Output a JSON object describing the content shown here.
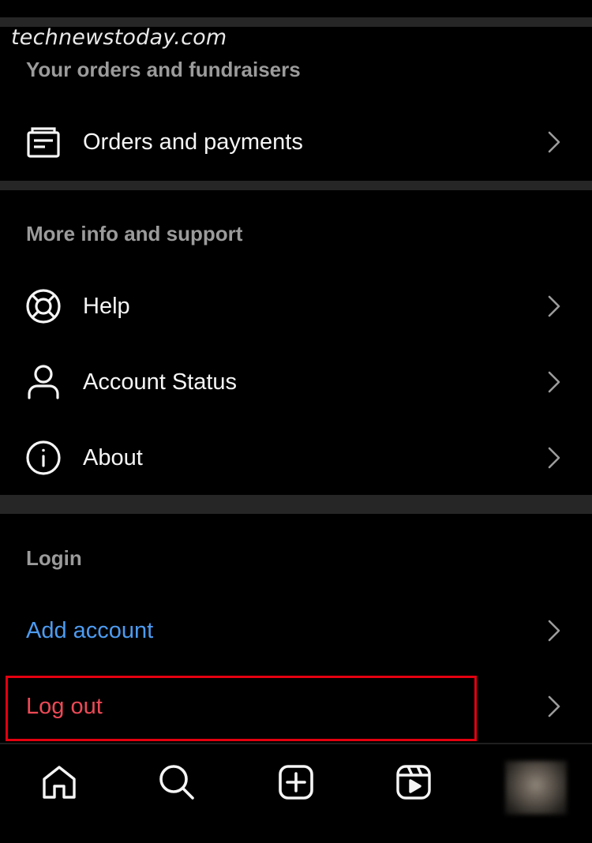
{
  "watermark": "technewstoday.com",
  "sections": {
    "orders": {
      "title": "Your orders and fundraisers",
      "items": [
        {
          "label": "Orders and payments",
          "icon": "receipt-icon"
        }
      ]
    },
    "support": {
      "title": "More info and support",
      "items": [
        {
          "label": "Help",
          "icon": "lifebuoy-icon"
        },
        {
          "label": "Account Status",
          "icon": "person-icon"
        },
        {
          "label": "About",
          "icon": "info-icon"
        }
      ]
    },
    "login": {
      "title": "Login",
      "items": [
        {
          "label": "Add account",
          "color": "#4d9bf0"
        },
        {
          "label": "Log out",
          "color": "#ed4956"
        }
      ]
    }
  },
  "tabbar": {
    "tabs": [
      "home-icon",
      "search-icon",
      "create-icon",
      "reels-icon",
      "profile-avatar"
    ]
  },
  "colors": {
    "background": "#000000",
    "divider": "#262626",
    "link_blue": "#4d9bf0",
    "danger_red": "#ed4956",
    "highlight_box": "#e3000f"
  }
}
